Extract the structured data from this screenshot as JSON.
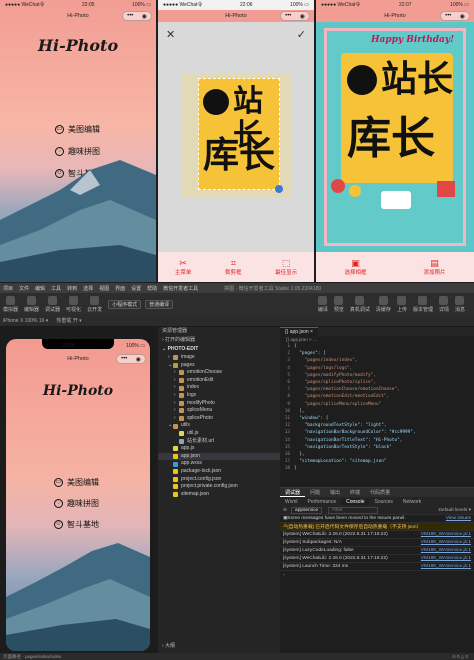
{
  "phone1": {
    "status_left": "●●●●● WeChat令",
    "status_time": "22:05",
    "status_right": "100% ▭",
    "nav_title": "Hi-Photo",
    "brand": "Hi-Photo",
    "menu": [
      {
        "icon": "image-icon",
        "label": "美图编辑"
      },
      {
        "icon": "heart-icon",
        "label": "趣味拼图"
      },
      {
        "icon": "smile-icon",
        "label": "智斗基地"
      }
    ]
  },
  "phone2": {
    "status_left": "●●●●● WeChat令",
    "status_time": "22:06",
    "status_right": "100% ▭",
    "nav_title": "Hi-Photo",
    "logo_text": "站长",
    "logo_text2": "库长",
    "actions": [
      {
        "icon": "✕",
        "label": "主菜单"
      },
      {
        "icon": "⌗",
        "label": "裁剪框"
      },
      {
        "icon": "⬚",
        "label": "最佳显示"
      }
    ]
  },
  "phone3": {
    "status_left": "●●●●● WeChat令",
    "status_time": "22:07",
    "status_right": "100% ▭",
    "nav_title": "Hi-Photo",
    "banner": "Happy Birthday!",
    "logo_text": "站长",
    "logo_text2": "库长",
    "actions": [
      {
        "icon": "▣",
        "label": "选择相框"
      },
      {
        "icon": "▤",
        "label": "添加照片"
      }
    ]
  },
  "ide": {
    "menubar": [
      "项目",
      "文件",
      "编辑",
      "工具",
      "转到",
      "选择",
      "视图",
      "界面",
      "设置",
      "帮助",
      "微信开发者工具"
    ],
    "window_title": "拼图 · 微信开发者工具 Stable 1.05.2204180",
    "toolbar": [
      "模拟器",
      "编辑器",
      "调试器",
      "可视化",
      "云开发"
    ],
    "mode_select": "小程序模式",
    "compile_select": "普通编译",
    "toolbar_right": [
      "编译",
      "预览",
      "真机调试",
      "清缓存",
      "上传",
      "版本管理",
      "详情",
      "消息"
    ],
    "sim_header": "iPhone X 100% 16 ▾",
    "sim_header2": "热重载 开 ▾",
    "sim_phone": {
      "time": "22:05",
      "nav_title": "Hi-Photo",
      "brand": "Hi-Photo",
      "menu": [
        {
          "icon": "image-icon",
          "label": "美图编辑"
        },
        {
          "icon": "heart-icon",
          "label": "趣味拼图"
        },
        {
          "icon": "smile-icon",
          "label": "智斗基地"
        }
      ]
    },
    "explorer_title": "资源管理器",
    "explorer_open": "› 打开的编辑器",
    "explorer_root": "⌄ PHOTO-EDIT",
    "files": [
      {
        "name": "image",
        "type": "folder",
        "depth": 1
      },
      {
        "name": "pages",
        "type": "folder",
        "depth": 1,
        "open": true
      },
      {
        "name": "emotionChoose",
        "type": "folder",
        "depth": 2
      },
      {
        "name": "emotionEdit",
        "type": "folder",
        "depth": 2
      },
      {
        "name": "index",
        "type": "folder",
        "depth": 2
      },
      {
        "name": "logs",
        "type": "folder",
        "depth": 2
      },
      {
        "name": "modifyPhoto",
        "type": "folder",
        "depth": 2
      },
      {
        "name": "spliceMenu",
        "type": "folder",
        "depth": 2
      },
      {
        "name": "splicePhoto",
        "type": "folder",
        "depth": 2
      },
      {
        "name": "utils",
        "type": "folder",
        "depth": 1,
        "open": true
      },
      {
        "name": "util.js",
        "type": "js",
        "depth": 2
      },
      {
        "name": "站长素材.url",
        "type": "url",
        "depth": 2
      },
      {
        "name": "app.js",
        "type": "js",
        "depth": 1
      },
      {
        "name": "app.json",
        "type": "json",
        "depth": 1
      },
      {
        "name": "app.wxss",
        "type": "wxss",
        "depth": 1
      },
      {
        "name": "package-lock.json",
        "type": "json",
        "depth": 1
      },
      {
        "name": "project.config.json",
        "type": "json",
        "depth": 1
      },
      {
        "name": "project.private.config.json",
        "type": "json",
        "depth": 1
      },
      {
        "name": "sitemap.json",
        "type": "json",
        "depth": 1
      }
    ],
    "outline": "› 大纲",
    "editor_tab": "{} app.json ×",
    "breadcrumb": "{} app.json > ...",
    "code": [
      {
        "n": "1",
        "t": "{"
      },
      {
        "n": "2",
        "t": "  \"pages\": ["
      },
      {
        "n": "3",
        "t": "    \"pages/index/index\","
      },
      {
        "n": "4",
        "t": "    \"pages/logs/logs\","
      },
      {
        "n": "5",
        "t": "    \"pages/modifyPhoto/modify\","
      },
      {
        "n": "6",
        "t": "    \"pages/splicePhoto/splice\","
      },
      {
        "n": "7",
        "t": "    \"pages/emotionChoose/emotionChoose\","
      },
      {
        "n": "8",
        "t": "    \"pages/emotionEdit/emotionEdit\","
      },
      {
        "n": "9",
        "t": "    \"pages/spliceMenu/spliceMenu\""
      },
      {
        "n": "10",
        "t": "  ],"
      },
      {
        "n": "11",
        "t": "  \"window\": {"
      },
      {
        "n": "12",
        "t": "    \"backgroundTextStyle\": \"light\","
      },
      {
        "n": "13",
        "t": "    \"navigationBarBackgroundColor\": \"#cc9999\","
      },
      {
        "n": "14",
        "t": "    \"navigationBarTitleText\": \"Hi-Photo\","
      },
      {
        "n": "15",
        "t": "    \"navigationBarTextStyle\": \"black\""
      },
      {
        "n": "16",
        "t": "  },"
      },
      {
        "n": "17",
        "t": "  \"sitemapLocation\": \"sitemap.json\""
      },
      {
        "n": "18",
        "t": "}"
      }
    ],
    "console_tabs": [
      "调试器",
      "问题",
      "输出",
      "终端",
      "代码质量"
    ],
    "devtools_tabs": [
      "Wxml",
      "Performance",
      "Console",
      "Sources",
      "Network"
    ],
    "console_filter_ctx": "appservice",
    "console_filter": "Filter",
    "console_levels": "Default levels ▾",
    "console_lines": [
      {
        "text": "Some messages have been moved to the Issues panel.",
        "src": "View issues",
        "kind": "info"
      },
      {
        "text": "[自动热重载] 已开启代码文件保存后自动热重载（不支持 json）",
        "src": "",
        "kind": "warn"
      },
      {
        "text": "[system] WeChatLib: 2.26.0 (2022.8.31 17:16:22)",
        "src": "VM188_WAService.js:1",
        "kind": "log"
      },
      {
        "text": "[system] Subpackages: N/A",
        "src": "VM188_WAService.js:1",
        "kind": "log"
      },
      {
        "text": "[system] LazyCodeLoading: false",
        "src": "VM188_WAService.js:1",
        "kind": "log"
      },
      {
        "text": "[system] WeChatLib: 2.26.0 (2022.8.31 17:16:22)",
        "src": "VM188_WAService.js:1",
        "kind": "log"
      },
      {
        "text": "[system] Launch Time: 334 ms",
        "src": "VM188_WAService.js:1",
        "kind": "log"
      }
    ],
    "status_left": "页面路径 · pages/index/index",
    "status_right": "⊙ 0 △ 0"
  }
}
